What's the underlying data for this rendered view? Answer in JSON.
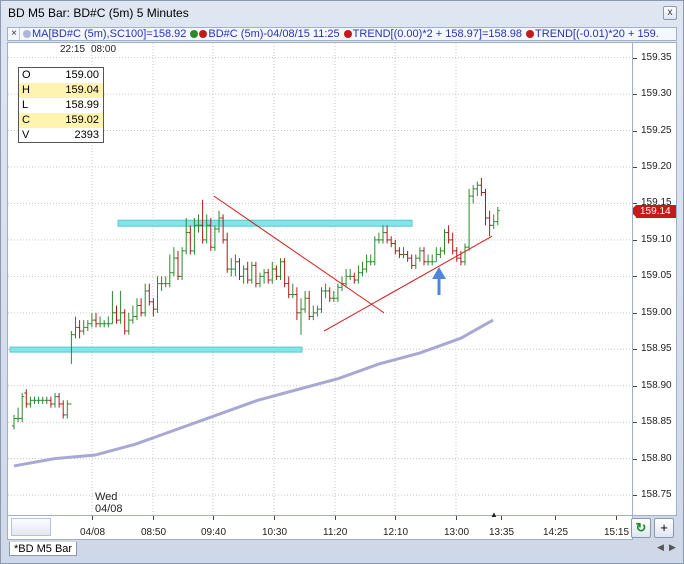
{
  "window": {
    "title": "BD M5 Bar: BD#C (5m) 5 Minutes",
    "close_label": "x"
  },
  "toolbar": {
    "close_label": "×",
    "legend": [
      {
        "label": "MA[BD#C (5m),SC100]=158.92",
        "dot_color": "#b0b4d8",
        "dot_color2": null
      },
      {
        "label": "BD#C (5m)-04/08/15 11:25",
        "dot_color": "#2a8a2a",
        "dot_color2": "#c41a1a"
      },
      {
        "label": "TREND[(0.00)*2 + 158.97]=158.98",
        "dot_color": "#c41a1a",
        "dot_color2": null
      },
      {
        "label": "TREND[(-0.01)*20 + 159.",
        "dot_color": "#c41a1a",
        "dot_color2": null
      }
    ]
  },
  "top_times": [
    "22:15",
    "08:00"
  ],
  "ohlc": [
    {
      "k": "O",
      "v": "159.00",
      "hl": false
    },
    {
      "k": "H",
      "v": "159.04",
      "hl": true
    },
    {
      "k": "L",
      "v": "158.99",
      "hl": false
    },
    {
      "k": "C",
      "v": "159.02",
      "hl": true
    },
    {
      "k": "V",
      "v": "2393",
      "hl": false
    }
  ],
  "y_axis": {
    "ticks": [
      "159.35",
      "159.30",
      "159.25",
      "159.20",
      "159.15",
      "159.10",
      "159.05",
      "159.00",
      "158.95",
      "158.90",
      "158.85",
      "158.80",
      "158.75"
    ],
    "last_price": "159.14"
  },
  "x_axis": {
    "date_label_top": "Wed",
    "date_label_bottom": "04/08",
    "ticks": [
      "04/08",
      "08:50",
      "09:40",
      "10:30",
      "11:20",
      "12:10",
      "13:00",
      "13:35",
      "14:25",
      "15:15"
    ]
  },
  "nav": {
    "refresh_icon": "↻",
    "zoom_label": "+"
  },
  "tab": {
    "label": "*BD M5 Bar"
  },
  "colors": {
    "up_bar": "#2a8a2a",
    "down_bar": "#b01818",
    "ma_line": "#a8a8d4",
    "trend_line": "#d41a1a",
    "zone": "#7fe6ea",
    "arrow": "#4f86d8",
    "grid": "#c8c8c8"
  },
  "chart_data": {
    "type": "bar",
    "series": [
      {
        "name": "BD#C (5m)",
        "x": [
          0,
          1,
          2,
          3,
          4,
          5,
          6,
          7,
          8,
          9,
          10,
          11,
          12,
          13,
          14,
          15,
          16,
          17,
          18,
          19,
          20,
          21,
          22,
          23,
          24,
          25,
          26,
          27,
          28,
          29,
          30,
          31,
          32,
          33,
          34,
          35,
          36,
          37,
          38,
          39,
          40,
          41,
          42,
          43,
          44,
          45,
          46,
          47,
          48,
          49,
          50,
          51,
          52,
          53,
          54,
          55,
          56,
          57,
          58,
          59,
          60,
          61,
          62,
          63,
          64,
          65,
          66,
          67,
          68,
          69,
          70,
          71,
          72,
          73,
          74,
          75,
          76,
          77,
          78,
          79,
          80,
          81,
          82,
          83,
          84,
          85,
          86,
          87,
          88,
          89,
          90,
          91,
          92,
          93,
          94,
          95,
          96,
          97,
          98,
          99,
          100,
          101,
          102,
          103,
          104,
          105,
          106,
          107,
          108,
          109,
          110,
          111,
          112,
          113,
          114,
          115,
          116,
          117,
          118
        ],
        "open": [
          158.845,
          158.855,
          158.855,
          158.89,
          158.875,
          158.88,
          158.88,
          158.88,
          158.88,
          158.88,
          158.875,
          158.885,
          158.875,
          158.86,
          158.875,
          158.97,
          158.98,
          158.975,
          158.98,
          158.985,
          158.99,
          158.985,
          158.985,
          158.985,
          158.985,
          159.0,
          158.99,
          159.0,
          158.975,
          158.99,
          158.995,
          159.01,
          159.0,
          159.03,
          159.015,
          159.005,
          159.04,
          159.04,
          159.04,
          159.055,
          159.075,
          159.05,
          159.085,
          159.11,
          159.085,
          159.12,
          159.12,
          159.1,
          159.12,
          159.09,
          159.115,
          159.13,
          159.1,
          159.06,
          159.06,
          159.07,
          159.05,
          159.06,
          159.045,
          159.065,
          159.04,
          159.05,
          159.055,
          159.045,
          159.06,
          159.05,
          159.07,
          159.04,
          159.025,
          159.025,
          159.0,
          159.005,
          159.02,
          158.995,
          159.0,
          159.005,
          159.03,
          159.03,
          159.02,
          159.02,
          159.035,
          159.04,
          159.05,
          159.05,
          159.045,
          159.055,
          159.06,
          159.07,
          159.07,
          159.1,
          159.1,
          159.11,
          159.1,
          159.095,
          159.085,
          159.08,
          159.08,
          159.075,
          159.065,
          159.075,
          159.085,
          159.07,
          159.07,
          159.07,
          159.08,
          159.085,
          159.11,
          159.1,
          159.085,
          159.075,
          159.07,
          159.09,
          159.16,
          159.17,
          159.175,
          159.165,
          159.13,
          159.12,
          159.125
        ],
        "close": [
          158.855,
          158.855,
          158.885,
          158.875,
          158.88,
          158.88,
          158.88,
          158.88,
          158.88,
          158.875,
          158.885,
          158.875,
          158.86,
          158.875,
          158.97,
          158.98,
          158.975,
          158.98,
          158.985,
          158.99,
          158.985,
          158.985,
          158.985,
          158.985,
          159.0,
          158.99,
          159.0,
          158.975,
          158.99,
          158.995,
          159.01,
          159.0,
          159.03,
          159.015,
          159.005,
          159.04,
          159.04,
          159.04,
          159.055,
          159.075,
          159.05,
          159.085,
          159.11,
          159.085,
          159.12,
          159.12,
          159.1,
          159.12,
          159.09,
          159.115,
          159.13,
          159.1,
          159.06,
          159.06,
          159.07,
          159.05,
          159.06,
          159.045,
          159.065,
          159.04,
          159.05,
          159.055,
          159.045,
          159.06,
          159.05,
          159.07,
          159.04,
          159.025,
          159.025,
          159.0,
          159.005,
          159.02,
          158.995,
          159.0,
          159.005,
          159.03,
          159.03,
          159.02,
          159.02,
          159.035,
          159.04,
          159.05,
          159.05,
          159.045,
          159.055,
          159.06,
          159.07,
          159.07,
          159.1,
          159.1,
          159.11,
          159.1,
          159.095,
          159.085,
          159.08,
          159.08,
          159.075,
          159.065,
          159.075,
          159.085,
          159.07,
          159.07,
          159.07,
          159.08,
          159.085,
          159.11,
          159.1,
          159.085,
          159.075,
          159.07,
          159.09,
          159.16,
          159.17,
          159.175,
          159.165,
          159.13,
          159.12,
          159.125,
          159.14
        ],
        "high": [
          158.86,
          158.87,
          158.89,
          158.895,
          158.885,
          158.885,
          158.885,
          158.885,
          158.885,
          158.885,
          158.89,
          158.89,
          158.88,
          158.88,
          158.975,
          158.995,
          158.99,
          158.99,
          158.99,
          159.0,
          159.0,
          158.995,
          158.99,
          158.995,
          159.03,
          159.01,
          159.03,
          159.005,
          159.0,
          159.01,
          159.02,
          159.02,
          159.04,
          159.04,
          159.02,
          159.05,
          159.05,
          159.05,
          159.08,
          159.09,
          159.085,
          159.09,
          159.13,
          159.12,
          159.13,
          159.135,
          159.155,
          159.135,
          159.13,
          159.12,
          159.14,
          159.135,
          159.11,
          159.075,
          159.08,
          159.075,
          159.065,
          159.07,
          159.07,
          159.07,
          159.055,
          159.06,
          159.06,
          159.07,
          159.065,
          159.075,
          159.075,
          159.05,
          159.04,
          159.035,
          159.02,
          159.03,
          159.03,
          159.01,
          159.01,
          159.035,
          159.04,
          159.035,
          159.03,
          159.04,
          159.05,
          159.06,
          159.06,
          159.055,
          159.065,
          159.07,
          159.08,
          159.08,
          159.105,
          159.11,
          159.12,
          159.12,
          159.105,
          159.1,
          159.09,
          159.09,
          159.085,
          159.08,
          159.08,
          159.09,
          159.09,
          159.08,
          159.08,
          159.09,
          159.09,
          159.115,
          159.12,
          159.11,
          159.09,
          159.085,
          159.095,
          159.17,
          159.175,
          159.18,
          159.185,
          159.17,
          159.14,
          159.135,
          159.145
        ],
        "low": [
          158.84,
          158.85,
          158.85,
          158.87,
          158.87,
          158.875,
          158.875,
          158.875,
          158.875,
          158.87,
          158.87,
          158.87,
          158.855,
          158.855,
          158.93,
          158.965,
          158.965,
          158.97,
          158.975,
          158.98,
          158.98,
          158.98,
          158.98,
          158.98,
          158.985,
          158.985,
          158.985,
          158.97,
          158.97,
          158.985,
          158.99,
          158.995,
          158.995,
          159.01,
          158.995,
          159.0,
          159.03,
          159.035,
          159.035,
          159.05,
          159.045,
          159.045,
          159.08,
          159.08,
          159.08,
          159.11,
          159.095,
          159.095,
          159.085,
          159.085,
          159.11,
          159.095,
          159.055,
          159.05,
          159.05,
          159.045,
          159.04,
          159.04,
          159.04,
          159.035,
          159.035,
          159.04,
          159.04,
          159.04,
          159.045,
          159.045,
          159.035,
          159.02,
          159.02,
          158.99,
          158.97,
          159.0,
          158.99,
          158.99,
          158.995,
          159.0,
          159.02,
          159.015,
          159.015,
          159.015,
          159.03,
          159.035,
          159.045,
          159.04,
          159.04,
          159.05,
          159.055,
          159.065,
          159.065,
          159.095,
          159.095,
          159.095,
          159.09,
          159.08,
          159.075,
          159.075,
          159.07,
          159.06,
          159.06,
          159.07,
          159.065,
          159.065,
          159.065,
          159.07,
          159.075,
          159.08,
          159.095,
          159.08,
          159.07,
          159.065,
          159.065,
          159.085,
          159.15,
          159.16,
          159.16,
          159.12,
          159.105,
          159.115,
          159.12
        ]
      },
      {
        "name": "MA[BD#C (5m),SC100]",
        "x": [
          0,
          10,
          20,
          30,
          40,
          50,
          60,
          70,
          80,
          90,
          100,
          110,
          118
        ],
        "values": [
          158.79,
          158.8,
          158.805,
          158.82,
          158.84,
          158.86,
          158.88,
          158.895,
          158.91,
          158.93,
          158.945,
          158.965,
          158.99
        ]
      }
    ],
    "x_tick_labels": [
      "04/08",
      "08:50",
      "09:40",
      "10:30",
      "11:20",
      "12:10",
      "13:00",
      "13:35",
      "14:25",
      "15:15"
    ],
    "ylim": [
      158.72,
      159.37
    ],
    "grid": true
  }
}
